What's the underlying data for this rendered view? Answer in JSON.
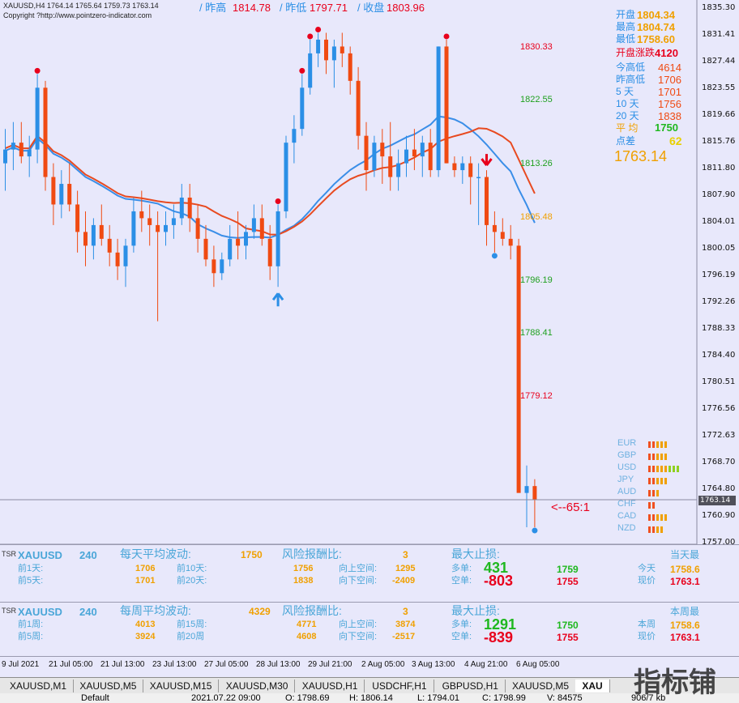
{
  "header": {
    "symbol_line": "XAUUSD,H4  1764.14 1765.64 1759.73 1763.14",
    "copyright": "Copyright ?http://www.pointzero-indicator.com",
    "prev_high_label": "/ 昨高",
    "prev_high": "1814.78",
    "prev_low_label": "/ 昨低",
    "prev_low": "1797.71",
    "close_label": "/ 收盘",
    "close": "1803.96"
  },
  "right_info": {
    "open_label": "开盘",
    "open": "1804.34",
    "high_label": "最高",
    "high": "1804.74",
    "low_label": "最低",
    "low": "1758.60",
    "open_change_label": "开盘涨跌",
    "open_change": "4120",
    "today_range_label": "今高低",
    "today_range": "4614",
    "prev_range_label": "昨高低",
    "prev_range": "1706",
    "d5_label": "5  天",
    "d5": "1701",
    "d10_label": "10  天",
    "d10": "1756",
    "d20_label": "20  天",
    "d20": "1838",
    "avg_label": "平  均",
    "avg": "1750",
    "spread_label": "点差",
    "spread": "62",
    "price": "1763.14"
  },
  "levels": [
    "1830.33",
    "1822.55",
    "1813.26",
    "1805.48",
    "1796.19",
    "1788.41",
    "1779.12"
  ],
  "price_axis": [
    "1835.30",
    "1831.41",
    "1827.44",
    "1823.55",
    "1819.66",
    "1815.76",
    "1811.80",
    "1807.90",
    "1804.01",
    "1800.05",
    "1796.19",
    "1792.26",
    "1788.33",
    "1784.40",
    "1780.51",
    "1776.56",
    "1772.63",
    "1768.70",
    "1764.80",
    "1760.90",
    "1757.00"
  ],
  "current_price_tag": "1763.14",
  "ratio_label": "<--65:1",
  "currencies": [
    "EUR",
    "GBP",
    "USD",
    "JPY",
    "AUD",
    "CHF",
    "CAD",
    "NZD"
  ],
  "time_axis": [
    "9 Jul 2021",
    "21 Jul 05:00",
    "21 Jul 13:00",
    "23 Jul 13:00",
    "27 Jul 05:00",
    "28 Jul 13:00",
    "29 Jul 21:00",
    "2 Aug 05:00",
    "3 Aug 13:00",
    "4 Aug 21:00",
    "6 Aug 05:00"
  ],
  "panel1": {
    "tag": "TSR",
    "symbol": "XAUUSD",
    "tf": "240",
    "avg_label": "每天平均波动:",
    "avg": "1750",
    "rr_label": "风险报酬比:",
    "rr": "3",
    "sl_label": "最大止损:",
    "p1_label": "前1天:",
    "p1": "1706",
    "p10_label": "前10天:",
    "p10": "1756",
    "p5_label": "前5天:",
    "p5": "1701",
    "p20_label": "前20天:",
    "p20": "1838",
    "up_label": "向上空间:",
    "up": "1295",
    "down_label": "向下空间:",
    "down": "-2409",
    "long_label": "多单:",
    "long": "431",
    "short_label": "空单:",
    "short": "-803",
    "long_price": "1759",
    "short_price": "1755",
    "right_title": "当天最",
    "today_label": "今天",
    "today_val": "1758.6",
    "now_label": "现价",
    "now_val": "1763.1"
  },
  "panel2": {
    "tag": "TSR",
    "symbol": "XAUUSD",
    "tf": "240",
    "avg_label": "每周平均波动:",
    "avg": "4329",
    "rr_label": "风险报酬比:",
    "rr": "3",
    "sl_label": "最大止损:",
    "p1_label": "前1周:",
    "p1": "4013",
    "p15_label": "前15周:",
    "p15": "4771",
    "p5_label": "前5周:",
    "p5": "3924",
    "p20_label": "前20周",
    "p20": "4608",
    "up_label": "向上空间:",
    "up": "3874",
    "down_label": "向下空间:",
    "down": "-2517",
    "long_label": "多单:",
    "long": "1291",
    "short_label": "空单:",
    "short": "-839",
    "long_price": "1750",
    "short_price": "1755",
    "right_title": "本周最",
    "week_label": "本周",
    "week_val": "1758.6",
    "now_label": "现价",
    "now_val": "1763.1"
  },
  "tabs": [
    "XAUUSD,M1",
    "XAUUSD,M5",
    "XAUUSD,M15",
    "XAUUSD,M30",
    "XAUUSD,H1",
    "USDCHF,H1",
    "GBPUSD,H1",
    "XAUUSD,M5",
    "XAU"
  ],
  "status": {
    "profile": "Default",
    "time": "2021.07.22 09:00",
    "open": "O: 1798.69",
    "high": "H: 1806.14",
    "low": "L: 1794.01",
    "close": "C: 1798.99",
    "vol": "V: 84575",
    "traffic": "906/7 kb"
  },
  "watermark": "指标铺",
  "colors": {
    "bg": "#e8e8fb",
    "bull": "#2b8fe6",
    "bear": "#f04a12",
    "ma_blue": "#3a8ee8",
    "ma_red": "#e84a20"
  },
  "chart_data": {
    "type": "candlestick",
    "ylim": [
      1757.0,
      1835.3
    ],
    "candles": [
      [
        1812,
        1817,
        1808,
        1814
      ],
      [
        1814,
        1818,
        1811,
        1815
      ],
      [
        1815,
        1818,
        1812,
        1813
      ],
      [
        1813,
        1816,
        1810,
        1814
      ],
      [
        1814,
        1825,
        1812,
        1823
      ],
      [
        1823,
        1824,
        1808,
        1810
      ],
      [
        1810,
        1812,
        1803,
        1806
      ],
      [
        1806,
        1811,
        1804,
        1809
      ],
      [
        1809,
        1812,
        1805,
        1806
      ],
      [
        1806,
        1808,
        1799,
        1802
      ],
      [
        1802,
        1805,
        1797,
        1800
      ],
      [
        1800,
        1804,
        1798,
        1803
      ],
      [
        1803,
        1806,
        1800,
        1801
      ],
      [
        1801,
        1803,
        1797,
        1799
      ],
      [
        1799,
        1801,
        1795,
        1797
      ],
      [
        1797,
        1801,
        1794,
        1800
      ],
      [
        1800,
        1807,
        1799,
        1805
      ],
      [
        1805,
        1808,
        1802,
        1804
      ],
      [
        1804,
        1806,
        1800,
        1803
      ],
      [
        1803,
        1805,
        1789,
        1802
      ],
      [
        1802,
        1805,
        1800,
        1803
      ],
      [
        1803,
        1806,
        1801,
        1804
      ],
      [
        1804,
        1809,
        1803,
        1807
      ],
      [
        1807,
        1809,
        1802,
        1804
      ],
      [
        1804,
        1806,
        1799,
        1801
      ],
      [
        1801,
        1803,
        1797,
        1798
      ],
      [
        1798,
        1800,
        1794,
        1796
      ],
      [
        1796,
        1799,
        1795,
        1798
      ],
      [
        1798,
        1803,
        1797,
        1801
      ],
      [
        1801,
        1805,
        1798,
        1800
      ],
      [
        1800,
        1803,
        1798,
        1802
      ],
      [
        1802,
        1806,
        1801,
        1804
      ],
      [
        1804,
        1806,
        1800,
        1801
      ],
      [
        1801,
        1803,
        1795,
        1797
      ],
      [
        1797,
        1806,
        1794,
        1805
      ],
      [
        1805,
        1816,
        1804,
        1815
      ],
      [
        1815,
        1819,
        1812,
        1817
      ],
      [
        1817,
        1825,
        1816,
        1823
      ],
      [
        1823,
        1830,
        1822,
        1828
      ],
      [
        1828,
        1831,
        1826,
        1830
      ],
      [
        1830,
        1831,
        1825,
        1827
      ],
      [
        1827,
        1830,
        1823,
        1829
      ],
      [
        1829,
        1831,
        1826,
        1828
      ],
      [
        1828,
        1829,
        1822,
        1824
      ],
      [
        1824,
        1826,
        1814,
        1816
      ],
      [
        1816,
        1818,
        1808,
        1811
      ],
      [
        1811,
        1816,
        1810,
        1815
      ],
      [
        1815,
        1817,
        1809,
        1813
      ],
      [
        1813,
        1818,
        1808,
        1810
      ],
      [
        1810,
        1814,
        1808,
        1812
      ],
      [
        1812,
        1816,
        1810,
        1814
      ],
      [
        1814,
        1817,
        1811,
        1813
      ],
      [
        1813,
        1816,
        1810,
        1815
      ],
      [
        1815,
        1817,
        1810,
        1811
      ],
      [
        1811,
        1829,
        1810,
        1829
      ],
      [
        1829,
        1830,
        1812,
        1812
      ],
      [
        1812,
        1813,
        1810,
        1811
      ],
      [
        1811,
        1813,
        1809,
        1812
      ],
      [
        1812,
        1813,
        1806,
        1810
      ],
      [
        1810,
        1812,
        1803,
        1810
      ],
      [
        1810,
        1811,
        1800,
        1803
      ],
      [
        1803,
        1805,
        1799,
        1802
      ],
      [
        1802,
        1804,
        1800,
        1801
      ],
      [
        1801,
        1803,
        1798,
        1800
      ],
      [
        1800,
        1801,
        1765,
        1764
      ],
      [
        1764,
        1768,
        1759,
        1765
      ],
      [
        1765,
        1766,
        1759,
        1763
      ]
    ]
  }
}
